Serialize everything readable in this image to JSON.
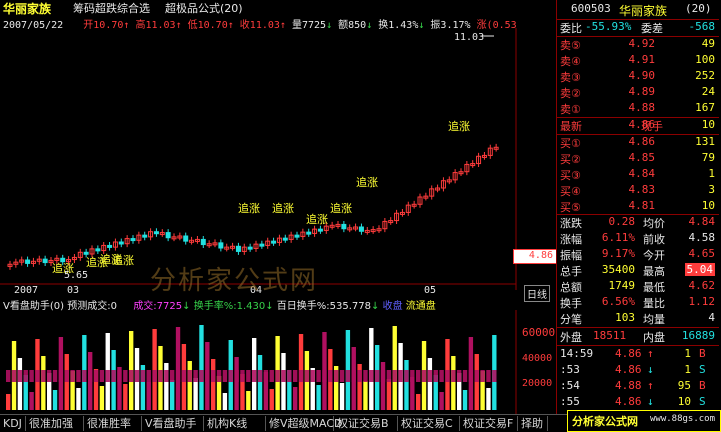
{
  "header": {
    "title": "华丽家族",
    "menu_items": [
      "筹码超跌综合选",
      "超极品公式(20)"
    ],
    "date": "2007/05/22",
    "ohlc": [
      {
        "label": "开",
        "value": "10.70",
        "arrow": "↑",
        "color": "#ff3c3c"
      },
      {
        "label": "高",
        "value": "11.03",
        "arrow": "↑",
        "color": "#ff3c3c"
      },
      {
        "label": "低",
        "value": "10.70",
        "arrow": "↑",
        "color": "#ff3c3c"
      },
      {
        "label": "收",
        "value": "11.03",
        "arrow": "↑",
        "color": "#ff3c3c"
      }
    ],
    "volume": "量7725",
    "volume_arrow": "↓",
    "amount": "额850",
    "amount_arrow": "↓",
    "turnover": "换1.43%",
    "turnover_arrow": "↓",
    "amplitude": "振3.17%",
    "change": "涨(0.53"
  },
  "main_chart": {
    "high_marker": "11.03",
    "low_marker": "5.65",
    "current_price_tag": "4.86",
    "axis_labels": [
      "2007",
      "03",
      "04",
      "05",
      "日线"
    ],
    "signal_label": "追涨",
    "signal_labels_left": [
      "追涨",
      "追涨",
      "追涨"
    ],
    "signal_labels_mid": [
      "追涨",
      "追涨",
      "追涨",
      "追涨"
    ],
    "signal_labels_right": [
      "追涨",
      "追涨",
      "追涨"
    ]
  },
  "sub_chart": {
    "indicator_title": "V看盘助手(0)",
    "predict_vol": "预测成交:0",
    "volume_label": "成交:7725",
    "volume_arrow": "↓",
    "turnover_label": "换手率%:1.430",
    "turnover_arrow": "↓",
    "hundred_day": "百日换手%:535.778",
    "hundred_day_arrow": "↓",
    "follow": "收盘",
    "follow2": "流通盘",
    "y_ticks": [
      "60000",
      "40000",
      "20000"
    ],
    "watermark": "分析家公式网"
  },
  "chart_data": {
    "type": "bar",
    "title": "",
    "xlabel": "",
    "ylabel": "",
    "ylim": [
      0,
      70000
    ],
    "categories": [],
    "values": []
  },
  "right_panel": {
    "code": "600503",
    "name": "华丽家族",
    "name_suffix": "(20)",
    "wei_bi_label": "委比",
    "wei_bi_value": "-55.93%",
    "wei_cha_label": "委差",
    "wei_cha_value": "-568",
    "sell": [
      {
        "label": "卖⑤",
        "price": "4.92",
        "vol": "49"
      },
      {
        "label": "卖④",
        "price": "4.91",
        "vol": "100"
      },
      {
        "label": "卖③",
        "price": "4.90",
        "vol": "252"
      },
      {
        "label": "卖②",
        "price": "4.89",
        "vol": "24"
      },
      {
        "label": "卖①",
        "price": "4.88",
        "vol": "167"
      }
    ],
    "latest_label": "最新",
    "latest_price": "4.86",
    "now_hand_label": "现手",
    "now_hand": "10",
    "buy": [
      {
        "label": "买①",
        "price": "4.86",
        "vol": "131"
      },
      {
        "label": "买②",
        "price": "4.85",
        "vol": "79"
      },
      {
        "label": "买③",
        "price": "4.84",
        "vol": "1"
      },
      {
        "label": "买④",
        "price": "4.83",
        "vol": "3"
      },
      {
        "label": "买⑤",
        "price": "4.81",
        "vol": "10"
      }
    ],
    "stats": [
      {
        "l1": "涨跌",
        "v1": "0.28",
        "l2": "均价",
        "v2": "4.84"
      },
      {
        "l1": "涨幅",
        "v1": "6.11%",
        "l2": "前收",
        "v2": "4.58"
      },
      {
        "l1": "振幅",
        "v1": "9.17%",
        "l2": "今开",
        "v2": "4.65"
      },
      {
        "l1": "总手",
        "v1": "35400",
        "l2": "最高",
        "v2": "5.04"
      },
      {
        "l1": "总额",
        "v1": "1749",
        "l2": "最低",
        "v2": "4.62"
      },
      {
        "l1": "换手",
        "v1": "6.56%",
        "l2": "量比",
        "v2": "1.12"
      },
      {
        "l1": "分笔",
        "v1": "103",
        "l2": "均量",
        "v2": "4"
      }
    ],
    "outer_label": "外盘",
    "outer_value": "18511",
    "inner_label": "内盘",
    "inner_value": "16889",
    "ticks": [
      {
        "time": "14:59",
        "price": "4.86",
        "vol": "1",
        "side": "B"
      },
      {
        "time": ":53",
        "price": "4.86",
        "vol": "1",
        "side": "S"
      },
      {
        "time": ":54",
        "price": "4.88",
        "vol": "95",
        "side": "B"
      },
      {
        "time": ":55",
        "price": "4.86",
        "vol": "10",
        "side": "S"
      }
    ]
  },
  "bottom_tabs": [
    "KDJ",
    "很准加强",
    "很准胜率",
    "V看盘助手",
    "机构K线",
    "修V超级MACD",
    "权证交易B",
    "权证交易C",
    "权证交易F",
    "择助"
  ],
  "brand_label": "分析家公式网",
  "brand_url": "www.88gs.com",
  "colors": {
    "up": "#ff3c3c",
    "down": "#22e0e0",
    "signal": "#ffff33",
    "grid": "#8b0000"
  }
}
